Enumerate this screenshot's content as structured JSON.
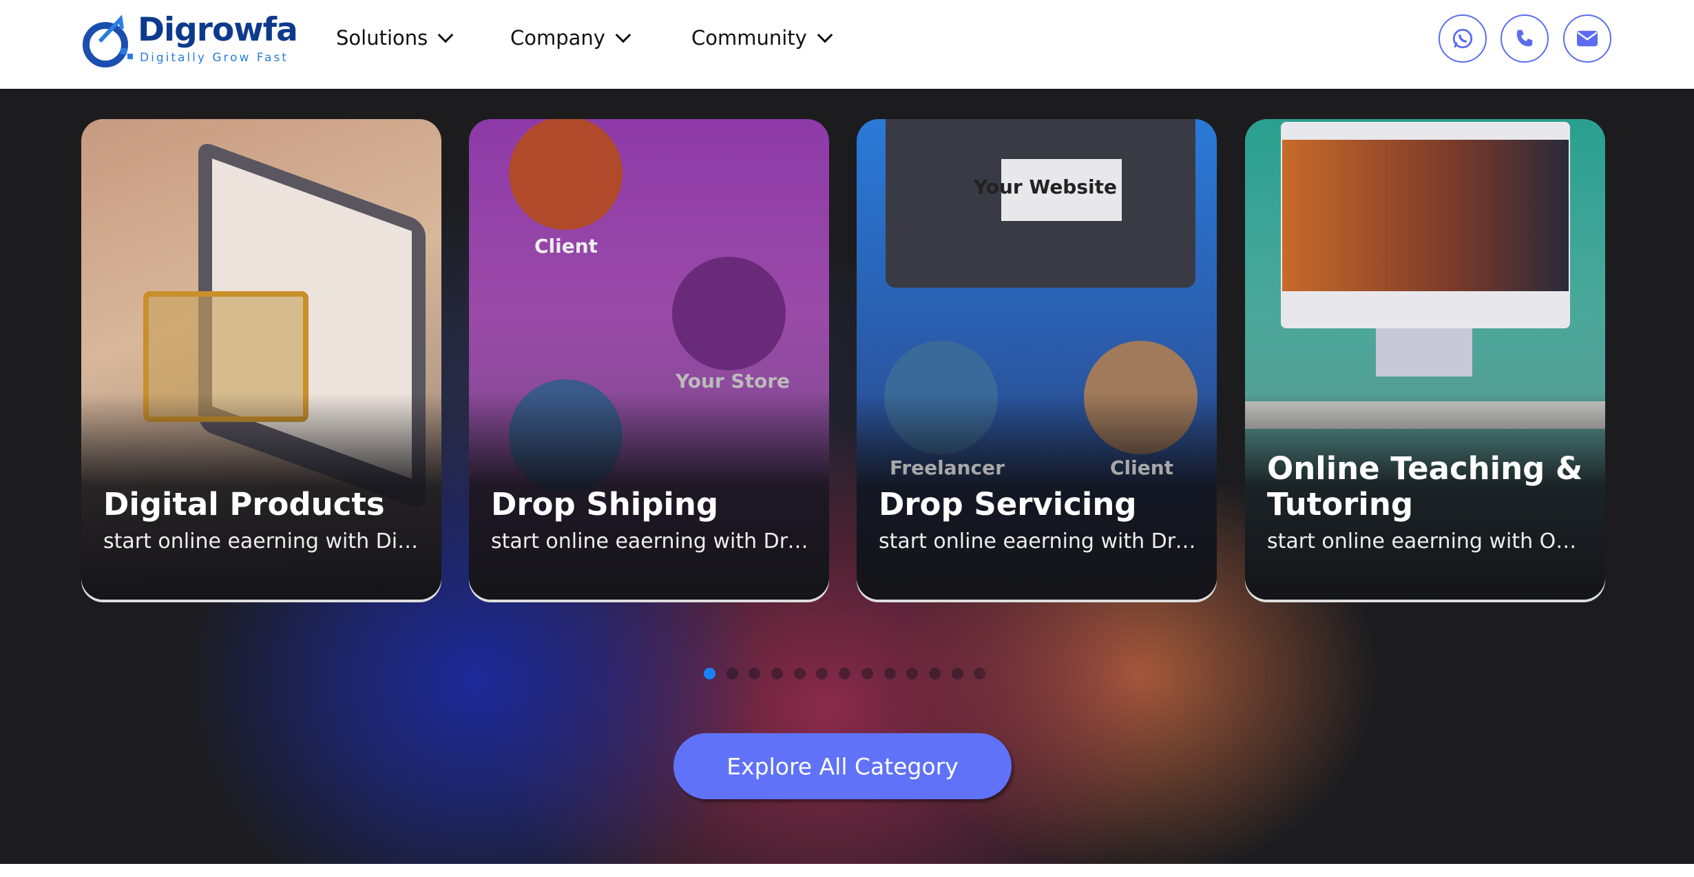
{
  "header": {
    "logo": {
      "name": "Digrowfa",
      "tagline": "Digitally Grow Fast"
    },
    "nav": [
      {
        "label": "Solutions"
      },
      {
        "label": "Company"
      },
      {
        "label": "Community"
      }
    ],
    "contact_icons": [
      "whatsapp-icon",
      "phone-icon",
      "mail-icon"
    ]
  },
  "cards": [
    {
      "title": "Digital Products",
      "subtitle": "start online eaerning with Digital Products"
    },
    {
      "title": "Drop Shiping",
      "subtitle": "start online eaerning with Drop Shiping",
      "art_labels": [
        "Client",
        "Your Store"
      ]
    },
    {
      "title": "Drop Servicing",
      "subtitle": "start online eaerning with Drop Servicing",
      "art_labels": [
        "Your Website",
        "Freelancer",
        "Client"
      ]
    },
    {
      "title": "Online Teaching & Tutoring",
      "subtitle": "start online eaerning with Online Teaching & Tutoring"
    }
  ],
  "carousel": {
    "total": 13,
    "active": 0
  },
  "cta": {
    "label": "Explore All Category"
  },
  "colors": {
    "accent": "#6072f8",
    "active_dot": "#1a82f7",
    "brand": "#0d3a8c"
  }
}
